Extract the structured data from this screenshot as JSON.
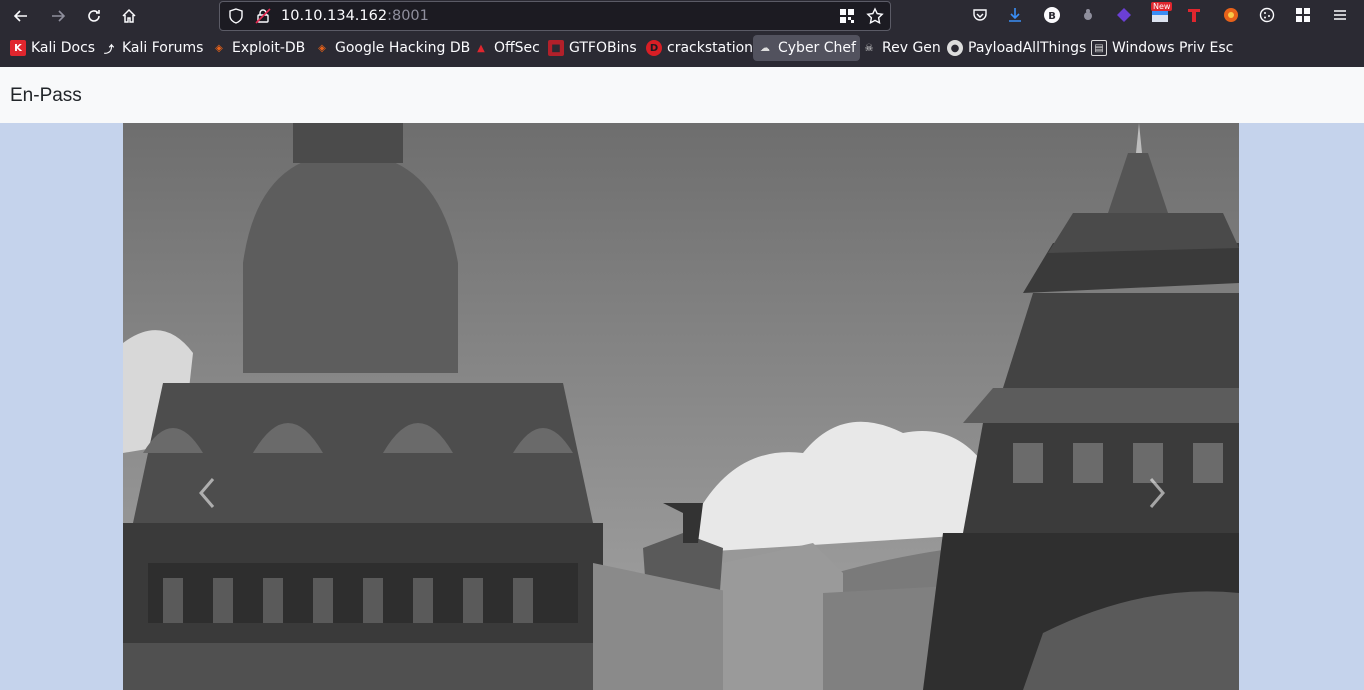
{
  "browser": {
    "url_host": "10.10.134.162",
    "url_port": ":8001",
    "badge_new": "New",
    "bookmarks": [
      {
        "label": "Kali Docs",
        "icon": "kali-docs-icon",
        "color": "#e0262e"
      },
      {
        "label": "Kali Forums",
        "icon": "kali-dragon-icon",
        "color": "#2b2a33"
      },
      {
        "label": "Exploit-DB",
        "icon": "exploit-db-icon",
        "color": "#e8621a"
      },
      {
        "label": "Google Hacking DB",
        "icon": "ghdb-icon",
        "color": "#e8621a"
      },
      {
        "label": "OffSec",
        "icon": "offsec-icon",
        "color": "#e0262e"
      },
      {
        "label": "GTFOBins",
        "icon": "gtfobins-icon",
        "color": "#b3202a"
      },
      {
        "label": "crackstation",
        "icon": "crackstation-icon",
        "color": "#d81e25"
      },
      {
        "label": "Cyber Chef",
        "icon": "chef-hat-icon",
        "color": "#dddddd"
      },
      {
        "label": "Rev Gen",
        "icon": "skull-icon",
        "color": "#dddddd"
      },
      {
        "label": "PayloadAllThings",
        "icon": "github-icon",
        "color": "#dddddd"
      },
      {
        "label": "Windows Priv Esc",
        "icon": "book-icon",
        "color": "#dddddd"
      }
    ]
  },
  "site": {
    "brand": "En-Pass"
  },
  "carousel": {
    "prev_icon": "chevron-left-icon",
    "next_icon": "chevron-right-icon"
  }
}
